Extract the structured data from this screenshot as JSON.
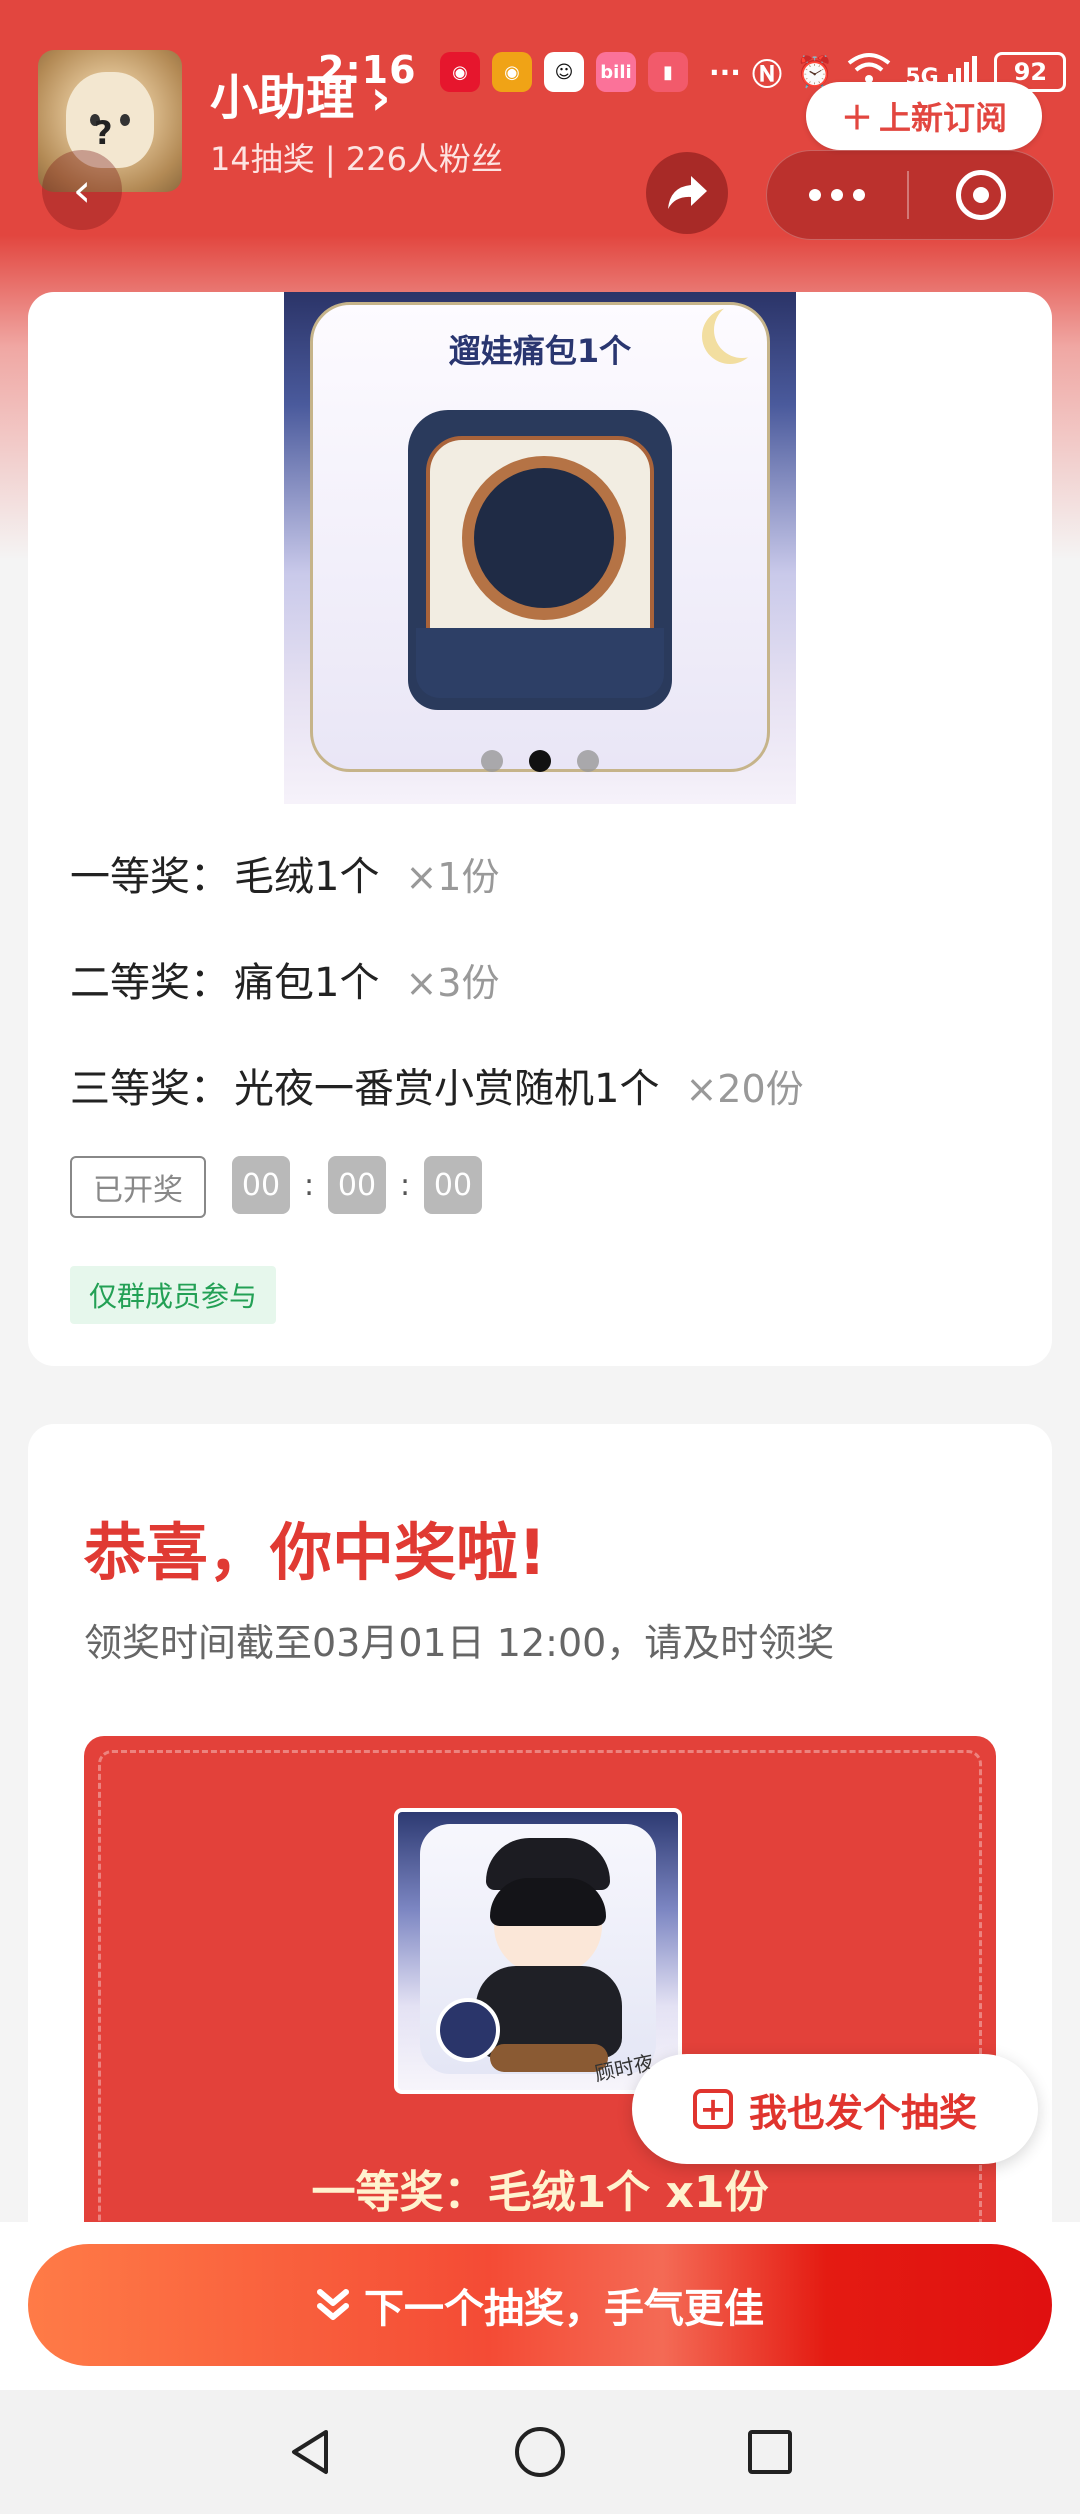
{
  "status_bar": {
    "time": "2:16",
    "apps": [
      {
        "icon": "weibo-icon",
        "color": "#e6162d",
        "label": ""
      },
      {
        "icon": "weibo-icon",
        "color": "#f0a316",
        "label": ""
      },
      {
        "icon": "qq-icon",
        "color": "#111111",
        "label": ""
      },
      {
        "icon": "bilibili-icon",
        "color": "#fb7299",
        "label": "bili"
      },
      {
        "icon": "book-icon",
        "color": "#f25a6b",
        "label": ""
      }
    ],
    "more": "···",
    "network": "5G",
    "battery": "92"
  },
  "header": {
    "title": "小助理",
    "title_arrow": "›",
    "stats": "14抽奖 | 226人粉丝",
    "subscribe_label": "上新订阅",
    "subscribe_icon": "plus-icon",
    "avatar_mark": "?"
  },
  "banner": {
    "title": "遛娃痛包1个",
    "slides": 3,
    "active_slide": 1
  },
  "prizes": [
    {
      "level": "一等奖：",
      "name": "毛绒1个",
      "qty": "×1份"
    },
    {
      "level": "二等奖：",
      "name": "痛包1个",
      "qty": "×3份"
    },
    {
      "level": "三等奖：",
      "name": "光夜一番赏小赏随机1个",
      "qty": "×20份"
    }
  ],
  "draw_status": "已开奖",
  "countdown": {
    "h": "00",
    "m": "00",
    "s": "00",
    "sep": ":"
  },
  "member_tag": "仅群成员参与",
  "win": {
    "title": "恭喜，你中奖啦!",
    "deadline": "领奖时间截至03月01日 12:00，请及时领奖",
    "prize_label": "一等奖：毛绒1个 x1份",
    "signature": "顾时夜"
  },
  "float_button": {
    "label": "我也发个抽奖"
  },
  "next_button": {
    "label": "下一个抽奖，手气更佳"
  },
  "colors": {
    "brand_red": "#e2463f",
    "win_red": "#e03a33",
    "member_green": "#23a055"
  }
}
